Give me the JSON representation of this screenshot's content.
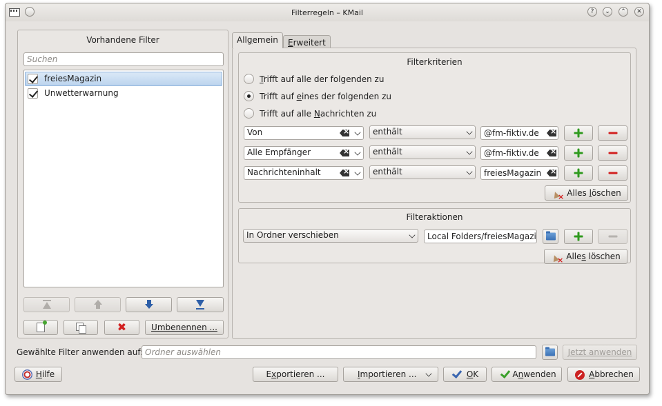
{
  "window": {
    "title": "Filterregeln – KMail",
    "controls": {
      "help": "?",
      "minimize": "⌄",
      "maximize": "⌃",
      "close": "✕"
    }
  },
  "left_panel": {
    "title": "Vorhandene Filter",
    "search_placeholder": "Suchen",
    "filters": [
      {
        "name": "freiesMagazin",
        "checked": true,
        "selected": true
      },
      {
        "name": "Unwetterwarnung",
        "checked": true,
        "selected": false
      }
    ],
    "rename_button": "Umbenennen ..."
  },
  "tabs": [
    {
      "label_pre": "All",
      "label_u": "g",
      "label_post": "emein",
      "active": true
    },
    {
      "label_pre": "",
      "label_u": "E",
      "label_post": "rweitert",
      "active": false
    }
  ],
  "criteria": {
    "title": "Filterkriterien",
    "radio_options": [
      {
        "pre": "",
        "u": "T",
        "post": "rifft auf alle der folgenden zu",
        "checked": false
      },
      {
        "pre": "Trifft auf ",
        "u": "e",
        "post": "ines der folgenden zu",
        "checked": true
      },
      {
        "pre": "Trifft auf alle ",
        "u": "N",
        "post": "achrichten zu",
        "checked": false
      }
    ],
    "rules": [
      {
        "field": "Von",
        "operator": "enthält",
        "value": "@fm-fiktiv.de"
      },
      {
        "field": "Alle Empfänger",
        "operator": "enthält",
        "value": "@fm-fiktiv.de"
      },
      {
        "field": "Nachrichteninhalt",
        "operator": "enthält",
        "value": "freiesMagazin"
      }
    ],
    "clear_all_pre": "Alles ",
    "clear_all_u": "l",
    "clear_all_post": "öschen"
  },
  "actions": {
    "title": "Filteraktionen",
    "action": "In Ordner verschieben",
    "folder": "Local Folders/freiesMagazin",
    "clear_all_pre": "Alle",
    "clear_all_u": "s",
    "clear_all_post": " löschen"
  },
  "apply_row": {
    "label": "Gewählte Filter anwenden auf:",
    "folder_placeholder": "Ordner auswählen",
    "apply_now": "Jetzt anwenden"
  },
  "bottom_buttons": {
    "help_u": "H",
    "help_post": "ilfe",
    "export_pre": "E",
    "export_u": "x",
    "export_post": "portieren ...",
    "import_pre": "",
    "import_u": "I",
    "import_post": "mportieren ...",
    "ok_u": "O",
    "ok_post": "K",
    "apply_pre": "A",
    "apply_u": "n",
    "apply_post": "wenden",
    "cancel_u": "A",
    "cancel_post": "bbrechen"
  }
}
